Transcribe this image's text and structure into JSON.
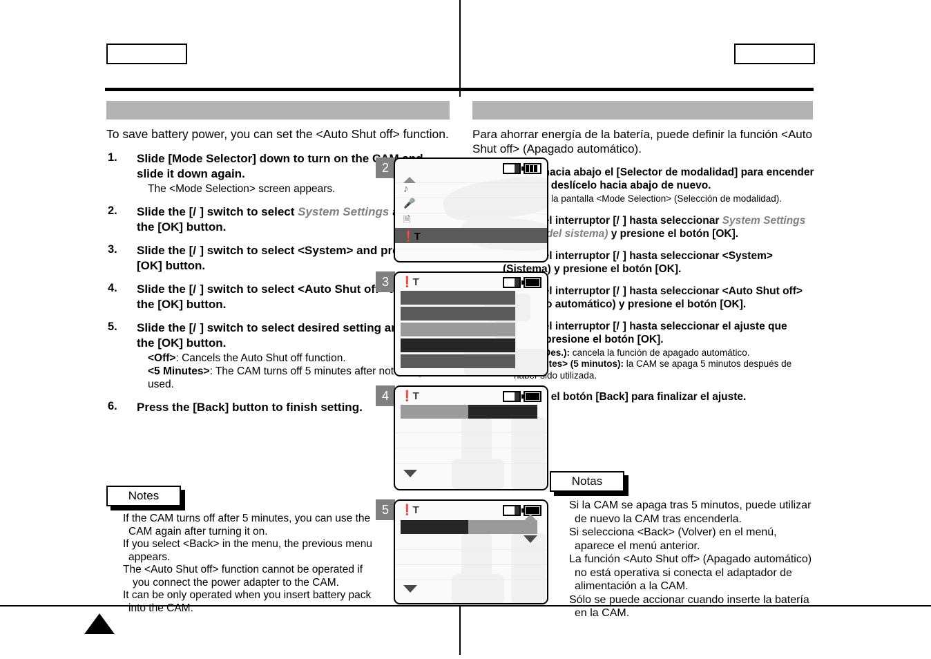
{
  "page": {
    "header_left_box": "",
    "header_right_box": "",
    "title_bar_left": "",
    "title_bar_right": ""
  },
  "english": {
    "intro": "To save battery power, you can set the <Auto Shut off> function.",
    "steps": [
      {
        "num": "1.",
        "main_parts": [
          "Slide [Mode Selector] down to turn on the CAM and slide it down again."
        ],
        "sub": [
          "The <Mode Selection> screen appears."
        ]
      },
      {
        "num": "2.",
        "main_pre": "Slide the [",
        "switch": "/",
        "main_mid": "] switch to select ",
        "italic": "System Settings",
        "main_post": " and press the [OK] button.",
        "sub": []
      },
      {
        "num": "3.",
        "main_pre": "Slide the [",
        "switch": "/",
        "main_mid": "] switch to select ",
        "main_post": "<System> and press the [OK] button.",
        "sub": []
      },
      {
        "num": "4.",
        "main_pre": "Slide the [",
        "switch": "/",
        "main_mid": "] switch to select ",
        "main_post": "<Auto Shut off> and press the [OK] button.",
        "sub": []
      },
      {
        "num": "5.",
        "main_pre": "Slide the [",
        "switch": "/",
        "main_mid": "] switch to select ",
        "main_post": "desired setting and press the [OK] button.",
        "sub_bold_1": "<Off>",
        "sub_text_1": ": Cancels the Auto Shut off function.",
        "sub_bold_2": "<5 Minutes>",
        "sub_text_2": ": The CAM turns off 5 minutes after not being used."
      },
      {
        "num": "6.",
        "main_parts": [
          "Press the [Back] button to finish setting."
        ],
        "sub": []
      }
    ],
    "notes_label": "Notes",
    "notes": [
      "If the CAM turns off after 5 minutes, you can use the CAM again after turning it on.",
      "If you select <Back> in the menu, the previous menu appears.",
      "The <Auto Shut off> function cannot be operated if you connect the power adapter to the CAM.",
      "It can be only operated when you insert battery pack into the CAM."
    ]
  },
  "spanish": {
    "intro": "Para ahorrar energía de la batería, puede definir la función <Auto Shut off> (Apagado automático).",
    "steps": [
      {
        "num": "1.",
        "main_parts": [
          "Deslice hacia abajo el [Selector de modalidad] para encender la CAM y deslícelo hacia abajo de nuevo."
        ],
        "sub": [
          "Aparece la pantalla <Mode Selection> (Selección de modalidad)."
        ]
      },
      {
        "num": "2.",
        "main_pre": "Deslice el interruptor [",
        "switch": "/",
        "main_mid": "] hasta seleccionar ",
        "italic": "System Settings (Config. del sistema)",
        "main_post": " y presione el botón [OK].",
        "sub": []
      },
      {
        "num": "3.",
        "main_pre": "Deslice el interruptor [",
        "switch": "/",
        "main_mid": "] hasta seleccionar ",
        "main_post": "<System> (Sistema) y presione el botón [OK].",
        "sub": []
      },
      {
        "num": "4.",
        "main_pre": "Deslice el interruptor [",
        "switch": "/",
        "main_mid": "] hasta seleccionar ",
        "main_post": "<Auto Shut off> (Apagado automático) y presione el botón [OK].",
        "sub": []
      },
      {
        "num": "5.",
        "main_pre": "Deslice el interruptor [",
        "switch": "/",
        "main_mid": "] hasta seleccionar ",
        "main_post": "el ajuste que desea y presione el botón [OK].",
        "sub_bold_1": "<Off> (Des.):",
        "sub_text_1": " cancela la función de apagado automático.",
        "sub_bold_2": "<5 Minutes> (5 minutos):",
        "sub_text_2": " la CAM se apaga 5 minutos después de haber sido utilizada."
      },
      {
        "num": "6.",
        "main_parts": [
          "Presione el botón [Back] para finalizar el ajuste."
        ],
        "sub": []
      }
    ],
    "notes_label": "Notas",
    "notes": [
      "Si la CAM se apaga tras 5 minutos, puede utilizar de nuevo la CAM tras encenderla.",
      "Si selecciona <Back> (Volver) en el menú, aparece el menú anterior.",
      "La función <Auto Shut off> (Apagado automático) no está operativa si conecta el adaptador de alimentación a la CAM.",
      "Sólo se puede accionar cuando inserte la batería en la CAM."
    ]
  },
  "screens": [
    {
      "tag": "2",
      "status_icons": [
        "memory-card-icon",
        "battery-full-icon"
      ],
      "menu_icons": [
        "arrow-up",
        "music-note-icon",
        "microphone-icon",
        "document-icon",
        "tools-icon"
      ],
      "highlighted_index": 4
    },
    {
      "tag": "3",
      "status_icons": [
        "tools-icon",
        "memory-card-icon",
        "battery-full-icon"
      ],
      "rows": 5,
      "highlighted_index": 3
    },
    {
      "tag": "4",
      "status_icons": [
        "tools-icon",
        "memory-card-icon",
        "battery-full-icon"
      ],
      "rows": 1,
      "scroll_down": true
    },
    {
      "tag": "5",
      "status_icons": [
        "tools-icon",
        "memory-card-icon",
        "battery-full-icon"
      ],
      "rows": 1,
      "scroll_up": true,
      "scroll_down": true
    }
  ],
  "colors": {
    "title_bar_gray": "#b3b3b3",
    "tag_gray": "#808080",
    "highlight_dark": "#262626",
    "highlight_mid": "#5a5a5a",
    "highlight_light": "#9a9a9a"
  }
}
